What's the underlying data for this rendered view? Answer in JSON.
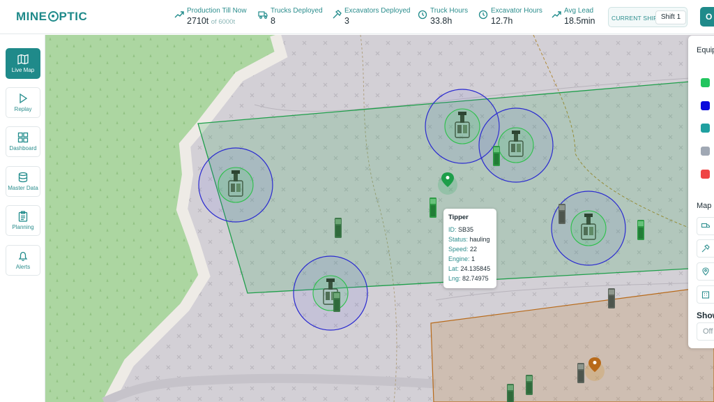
{
  "app": {
    "logo_left": "MINE",
    "logo_right": "PTIC"
  },
  "stats": [
    {
      "label": "Production Till Now",
      "value": "2710t",
      "of": "of 6000t",
      "icon": "trend-up-icon"
    },
    {
      "label": "Trucks Deployed",
      "value": "8",
      "icon": "truck-icon"
    },
    {
      "label": "Excavators Deployed",
      "value": "3",
      "icon": "hammer-icon"
    },
    {
      "label": "Truck Hours",
      "value": "33.8h",
      "icon": "clock-icon"
    },
    {
      "label": "Excavator Hours",
      "value": "12.7h",
      "icon": "clock-icon"
    },
    {
      "label": "Avg Lead",
      "value": "18.5min",
      "icon": "trend-up-icon"
    }
  ],
  "shift": {
    "label": "CURRENT SHIFT",
    "value": "Shift 1"
  },
  "top_button": {
    "label": "O"
  },
  "nav": [
    {
      "label": "Live Map",
      "icon": "map-icon",
      "active": true
    },
    {
      "label": "Replay",
      "icon": "play-icon"
    },
    {
      "label": "Dashboard",
      "icon": "dashboard-icon"
    },
    {
      "label": "Master Data",
      "icon": "database-icon"
    },
    {
      "label": "Planning",
      "icon": "clipboard-icon"
    },
    {
      "label": "Alerts",
      "icon": "bell-icon"
    }
  ],
  "tooltip": {
    "title": "Tipper",
    "rows": [
      {
        "key": "ID:",
        "value": "SB35"
      },
      {
        "key": "Status:",
        "value": "hauling"
      },
      {
        "key": "Speed:",
        "value": "22"
      },
      {
        "key": "Engine:",
        "value": "1"
      },
      {
        "key": "Lat:",
        "value": "24.135845"
      },
      {
        "key": "Lng:",
        "value": "82.74975"
      }
    ]
  },
  "panel": {
    "legend_heading": "Equip",
    "legend_colors": [
      "#22c55e",
      "#0a0adc",
      "#20a0a0",
      "#a0a8b4",
      "#ef4444"
    ],
    "map_heading": "Map",
    "map_buttons": [
      "truck-icon",
      "hammer-icon",
      "pin-icon",
      "building-icon"
    ],
    "show_heading": "Show",
    "show_value": "Off"
  },
  "colors": {
    "accent": "#1f8a8a",
    "zone_green": "#1e9e4a",
    "zone_orange": "#b86a1a",
    "range_ring": "#2a2ad0"
  }
}
